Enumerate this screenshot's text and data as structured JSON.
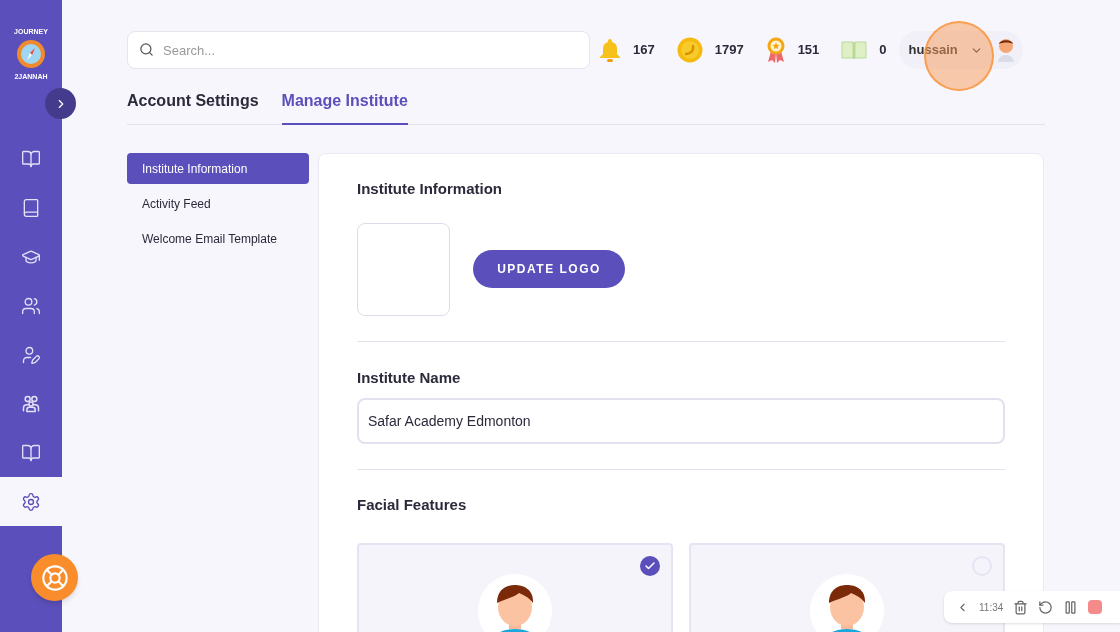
{
  "logo": {
    "top_text": "JOURNEY",
    "bottom_text": "2JANNAH"
  },
  "sidebar": {
    "items": [
      {
        "kind": "book-open",
        "selected": false
      },
      {
        "kind": "book",
        "selected": false
      },
      {
        "kind": "graduation",
        "selected": false
      },
      {
        "kind": "users",
        "selected": false
      },
      {
        "kind": "user-pen",
        "selected": false
      },
      {
        "kind": "group",
        "selected": false
      },
      {
        "kind": "book-open",
        "selected": false
      },
      {
        "kind": "settings",
        "selected": true
      }
    ]
  },
  "search": {
    "placeholder": "Search..."
  },
  "stats": [
    {
      "kind": "bell",
      "value": "167"
    },
    {
      "kind": "coin",
      "value": "1797"
    },
    {
      "kind": "award",
      "value": "151"
    },
    {
      "kind": "book",
      "value": "0"
    }
  ],
  "user": {
    "name": "hussain"
  },
  "tabs": [
    {
      "label": "Account Settings",
      "selected": false
    },
    {
      "label": "Manage Institute",
      "selected": true
    }
  ],
  "settings_menu": [
    {
      "label": "Institute Information",
      "selected": true
    },
    {
      "label": "Activity Feed",
      "selected": false
    },
    {
      "label": "Welcome Email Template",
      "selected": false
    }
  ],
  "institute_info": {
    "title": "Institute Information",
    "button": "UPDATE LOGO"
  },
  "institute_name": {
    "label": "Institute Name",
    "value": "Safar Academy Edmonton"
  },
  "facial_features": {
    "title": "Facial Features",
    "options": [
      {
        "selected": true
      },
      {
        "selected": false
      }
    ]
  },
  "recorder": {
    "time": "11:34"
  }
}
